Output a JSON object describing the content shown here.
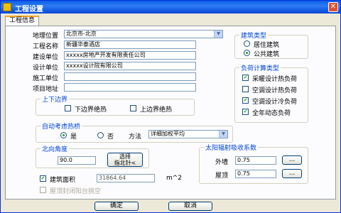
{
  "window": {
    "title": "工程设置",
    "close": "✕"
  },
  "tabs": [
    "工程信息"
  ],
  "info": {
    "location_label": "地理位置",
    "location_value": "北京市-北京",
    "name_label": "工程名称",
    "name_value": "新疆华泰酒店",
    "builder_label": "建设单位",
    "builder_value": "xxxxx房地产开发有限责任公司",
    "designer_label": "设计单位",
    "designer_value": "xxxxx设计院有限公司",
    "constructor_label": "施工单位",
    "constructor_value": "",
    "address_label": "项目地址",
    "address_value": ""
  },
  "building_type": {
    "title": "建筑类型",
    "options": [
      "居住建筑",
      "公共建筑"
    ],
    "selected": 1
  },
  "load_type": {
    "title": "负荷计算类型",
    "items": [
      {
        "label": "采暖设计热负荷",
        "checked": true
      },
      {
        "label": "空调设计热负荷",
        "checked": false
      },
      {
        "label": "空调设计冷负荷",
        "checked": true
      },
      {
        "label": "全年动态负荷",
        "checked": true
      }
    ]
  },
  "boundary": {
    "title": "上下边界",
    "lower": "下边界绝热",
    "upper": "上边界绝热"
  },
  "auto_bridge": {
    "title": "自动考虑热桥",
    "yes": "是",
    "no": "否",
    "method_label": "方法",
    "method_value": "详细加权平均",
    "selected": "yes"
  },
  "north": {
    "title": "北向角度",
    "value": "90.0",
    "button": "选择\n指北针<"
  },
  "area": {
    "label": "建筑面积",
    "value": "31864.64",
    "unit": "m^2",
    "checked": true
  },
  "roof_enclosed": {
    "label": "屋顶封闭阳台挑空",
    "checked": false
  },
  "solar": {
    "title": "太阳辐射吸收系数",
    "wall_label": "外墙",
    "wall_value": "0.75",
    "roof_label": "屋顶",
    "roof_value": "0.75",
    "button": "..."
  },
  "footer": {
    "ok": "确定",
    "cancel": "取消"
  }
}
